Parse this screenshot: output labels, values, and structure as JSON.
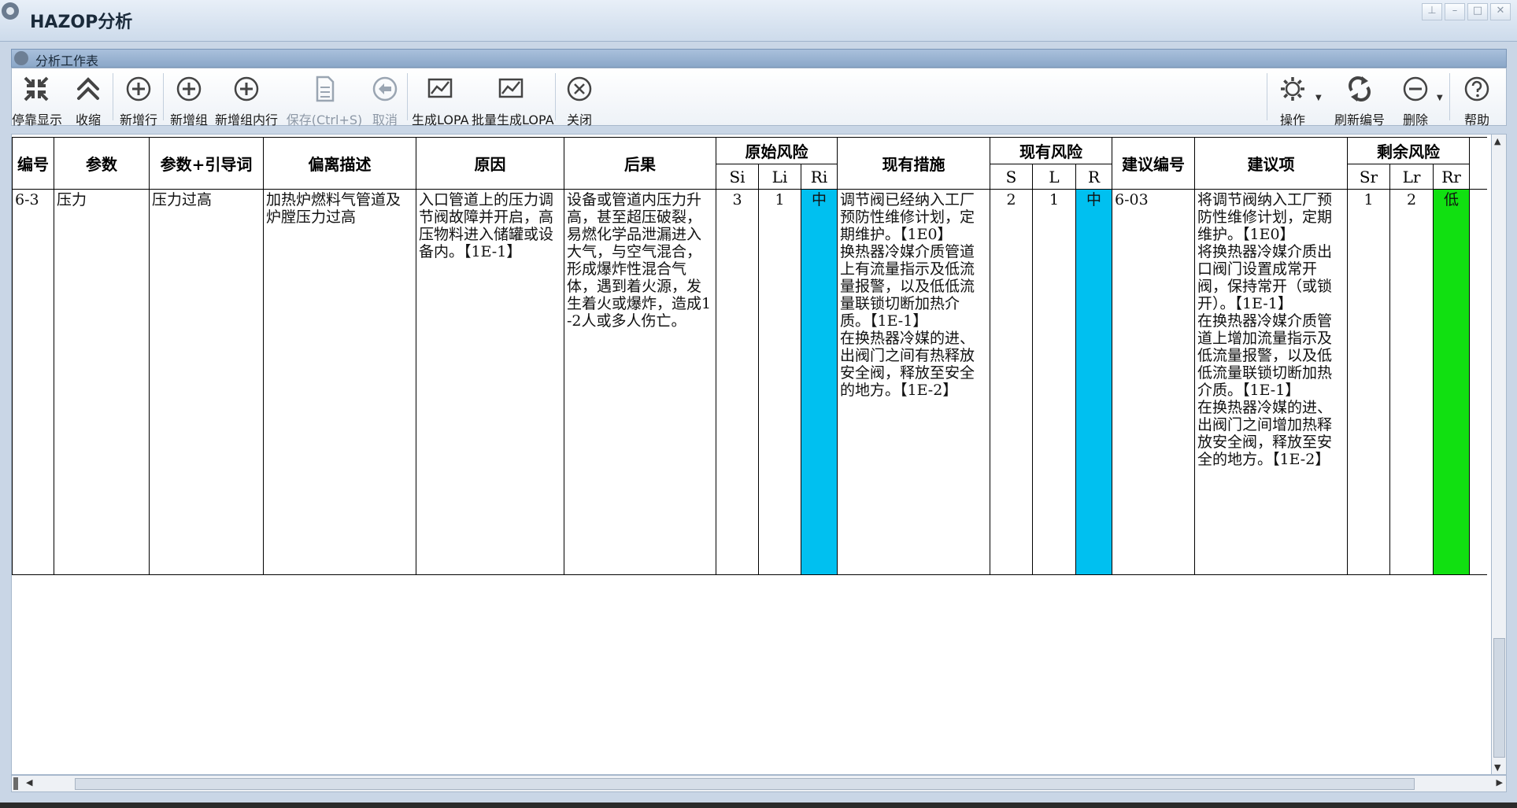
{
  "window": {
    "title": "HAZOP分析"
  },
  "panel": {
    "title": "分析工作表"
  },
  "toolbar": {
    "dock": "停靠显示",
    "collapse": "收缩",
    "add_row": "新增行",
    "add_group": "新增组",
    "add_group_row": "新增组内行",
    "save": "保存(Ctrl+S)",
    "cancel": "取消",
    "gen_lopa": "生成LOPA",
    "batch_lopa": "批量生成LOPA",
    "close": "关闭",
    "operate": "操作",
    "renumber": "刷新编号",
    "delete": "删除",
    "help": "帮助"
  },
  "colors": {
    "risk_medium": "#00c0f0",
    "risk_low": "#11e011"
  },
  "table": {
    "headers": {
      "id": "编号",
      "param": "参数",
      "param_guide": "参数+引导词",
      "deviation": "偏离描述",
      "cause": "原因",
      "consequence": "后果",
      "orig_risk": "原始风险",
      "si": "Si",
      "li": "Li",
      "ri": "Ri",
      "measures": "现有措施",
      "curr_risk": "现有风险",
      "s": "S",
      "l": "L",
      "r": "R",
      "rec_no": "建议编号",
      "recommendation": "建议项",
      "resid_risk": "剩余风险",
      "sr": "Sr",
      "lr": "Lr",
      "rr": "Rr"
    },
    "rows": [
      {
        "id": "6-3",
        "param": "压力",
        "param_guide": "压力过高",
        "deviation": "加热炉燃料气管道及炉膛压力过高",
        "cause": "入口管道上的压力调节阀故障并开启，高压物料进入储罐或设备内。【1E-1】",
        "consequence": "设备或管道内压力升高，甚至超压破裂，易燃化学品泄漏进入大气，与空气混合，形成爆炸性混合气体，遇到着火源，发生着火或爆炸，造成1-2人或多人伤亡。",
        "si": "3",
        "li": "1",
        "ri": "中",
        "measures": "调节阀已经纳入工厂预防性维修计划，定期维护。【1E0】\n换热器冷媒介质管道上有流量指示及低流量报警，以及低低流量联锁切断加热介质。【1E-1】\n在换热器冷媒的进、出阀门之间有热释放安全阀，释放至安全的地方。【1E-2】",
        "s": "2",
        "l": "1",
        "r": "中",
        "rec_no": "6-03",
        "recommendation": "将调节阀纳入工厂预防性维修计划，定期维护。【1E0】\n将换热器冷媒介质出口阀门设置成常开阀，保持常开（或锁开）。【1E-1】\n在换热器冷媒介质管道上增加流量指示及低流量报警，以及低低流量联锁切断加热介质。【1E-1】\n在换热器冷媒的进、出阀门之间增加热释放安全阀，释放至安全的地方。【1E-2】",
        "sr": "1",
        "lr": "2",
        "rr": "低"
      }
    ]
  }
}
